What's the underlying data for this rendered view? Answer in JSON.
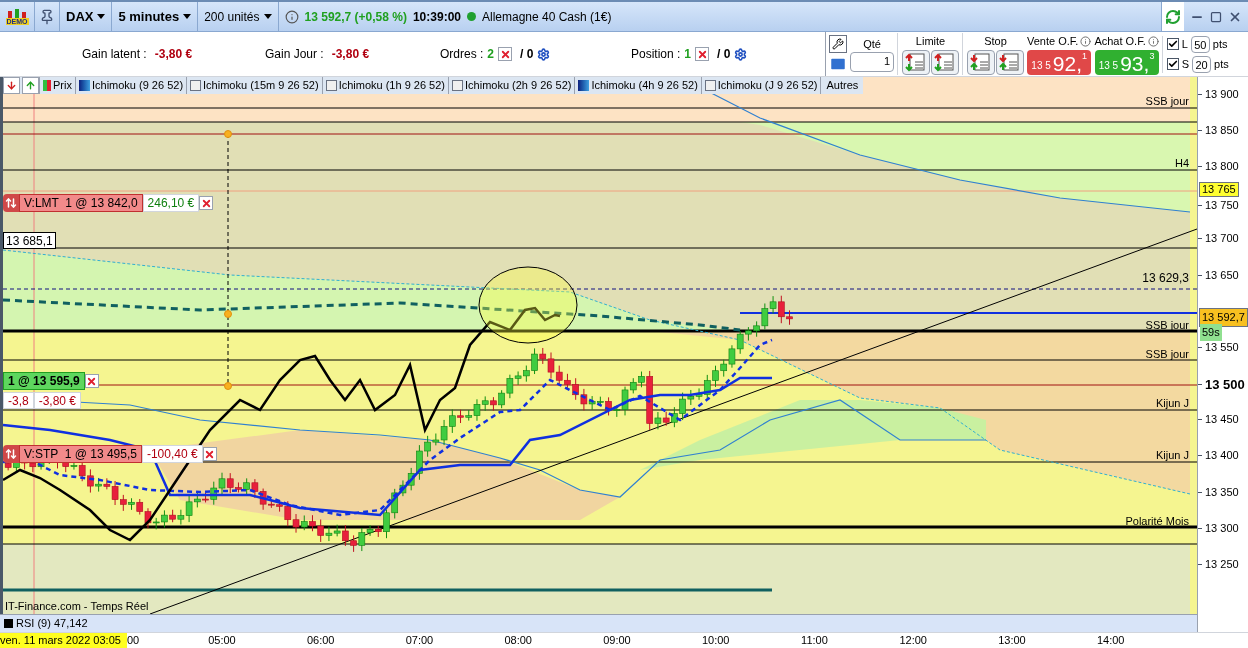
{
  "toolbar": {
    "logo_text": "DEMO",
    "instrument": "DAX",
    "timeframe": "5 minutes",
    "units": "200 unités",
    "quote": "13 592,7 (+0,58 %)",
    "time": "10:39:00",
    "market": "Allemagne 40 Cash (1€)"
  },
  "summary": [
    {
      "label": "Gain latent :",
      "value": "-3,80 €"
    },
    {
      "label": "Gain Jour :",
      "value": "-3,80 €"
    }
  ],
  "counters": [
    {
      "label": "Ordres :",
      "count": "2",
      "rest": "/ 0"
    },
    {
      "label": "Position :",
      "count": "1",
      "rest": "/ 0"
    }
  ],
  "trade_panel": {
    "qty_label": "Qté",
    "qty": "1",
    "limit_label": "Limite",
    "stop_label": "Stop",
    "sell": {
      "label": "Vente O.F.",
      "prefix": "13 5",
      "main": "92,",
      "tail": "1"
    },
    "buy": {
      "label": "Achat O.F.",
      "prefix": "13 5",
      "main": "93,",
      "tail": "3"
    },
    "distances": [
      {
        "checked": true,
        "label": "L",
        "value": "50",
        "unit": "pts"
      },
      {
        "checked": true,
        "label": "S",
        "value": "20",
        "unit": "pts"
      }
    ]
  },
  "indicators": [
    {
      "kind": "price",
      "label": "Prix",
      "enabled": true
    },
    {
      "kind": "ichimoku",
      "label": "Ichimoku (9 26 52)",
      "enabled": true
    },
    {
      "kind": "ichimoku",
      "label": "Ichimoku (15m 9 26 52)",
      "enabled": false
    },
    {
      "kind": "ichimoku",
      "label": "Ichimoku (1h 9 26 52)",
      "enabled": false
    },
    {
      "kind": "ichimoku",
      "label": "Ichimoku (2h 9 26 52)",
      "enabled": false
    },
    {
      "kind": "ichimoku",
      "label": "Ichimoku (4h 9 26 52)",
      "enabled": true
    },
    {
      "kind": "ichimoku",
      "label": "Ichimoku (J 9 26 52)",
      "enabled": false
    }
  ],
  "more_button": "Autres",
  "chart": {
    "orders": [
      {
        "kind": "limit",
        "label": "V:LMT  1 @ 13 842,0",
        "pnl": "246,10 €"
      },
      {
        "kind": "position",
        "label": "1 @ 13 595,9",
        "points": "-3,8",
        "pnl": "-3,80 €"
      },
      {
        "kind": "stop",
        "label": "V:STP  1 @ 13 495,5",
        "pnl": "-100,40 €"
      }
    ],
    "crosshair_price": "13 685,1",
    "level_labels": [
      "SSB jour",
      "H4",
      "13 629,3",
      "SSB jour",
      "SSB jour",
      "Kijun J",
      "Kijun J",
      "Polarité Mois"
    ],
    "source": "IT-Finance.com - Temps Réel"
  },
  "price_axis": {
    "ticks": [
      {
        "label": "13 900",
        "major": false
      },
      {
        "label": "13 850",
        "major": false
      },
      {
        "label": "13 800",
        "major": false
      },
      {
        "label": "13 750",
        "major": false
      },
      {
        "label": "13 700",
        "major": false
      },
      {
        "label": "13 650",
        "major": false
      },
      {
        "label": "13 550",
        "major": false
      },
      {
        "label": "13 500",
        "major": true
      },
      {
        "label": "13 450",
        "major": false
      },
      {
        "label": "13 400",
        "major": false
      },
      {
        "label": "13 350",
        "major": false
      },
      {
        "label": "13 300",
        "major": false
      },
      {
        "label": "13 250",
        "major": false
      }
    ],
    "marker": "13 765",
    "current_price": "13 592,7",
    "timer": "59s"
  },
  "rsi": {
    "label": "RSI (9) 47,142"
  },
  "time_axis": {
    "cursor_date": "ven. 11 mars 2022 03:05",
    "ticks": [
      "00",
      "05:00",
      "06:00",
      "07:00",
      "08:00",
      "09:00",
      "10:00",
      "11:00",
      "12:00",
      "13:00",
      "14:00"
    ]
  }
}
